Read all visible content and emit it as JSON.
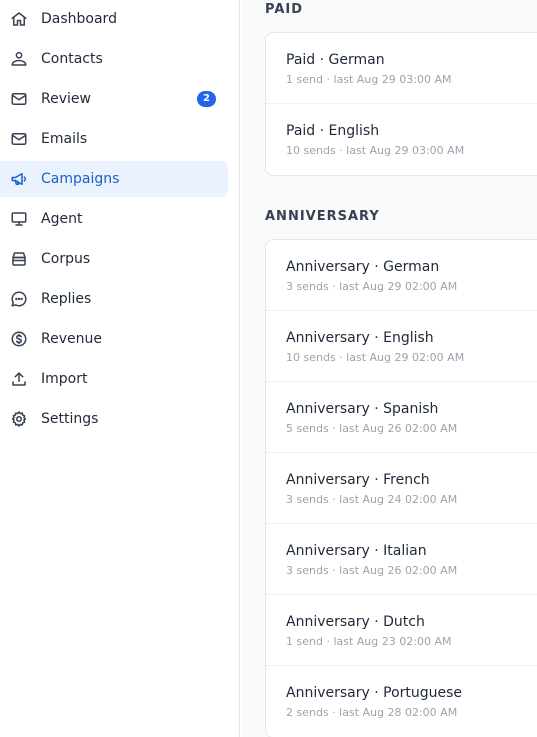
{
  "sidebar": {
    "items": [
      {
        "label": "Dashboard",
        "icon": "home-icon"
      },
      {
        "label": "Contacts",
        "icon": "contacts-icon"
      },
      {
        "label": "Review",
        "icon": "mail-icon",
        "badge": "2"
      },
      {
        "label": "Emails",
        "icon": "mail-icon"
      },
      {
        "label": "Campaigns",
        "icon": "megaphone-icon",
        "active": true
      },
      {
        "label": "Agent",
        "icon": "monitor-icon"
      },
      {
        "label": "Corpus",
        "icon": "archive-icon"
      },
      {
        "label": "Replies",
        "icon": "chat-icon"
      },
      {
        "label": "Revenue",
        "icon": "dollar-icon"
      },
      {
        "label": "Import",
        "icon": "upload-icon"
      },
      {
        "label": "Settings",
        "icon": "gear-icon"
      }
    ]
  },
  "main": {
    "sections": [
      {
        "title": "PAID",
        "rows": [
          {
            "title": "Paid · German",
            "subtitle": "1 send · last Aug 29 03:00 AM"
          },
          {
            "title": "Paid · English",
            "subtitle": "10 sends · last Aug 29 03:00 AM"
          }
        ]
      },
      {
        "title": "ANNIVERSARY",
        "rows": [
          {
            "title": "Anniversary · German",
            "subtitle": "3 sends · last Aug 29 02:00 AM"
          },
          {
            "title": "Anniversary · English",
            "subtitle": "10 sends · last Aug 29 02:00 AM"
          },
          {
            "title": "Anniversary · Spanish",
            "subtitle": "5 sends · last Aug 26 02:00 AM"
          },
          {
            "title": "Anniversary · French",
            "subtitle": "3 sends · last Aug 24 02:00 AM"
          },
          {
            "title": "Anniversary · Italian",
            "subtitle": "3 sends · last Aug 26 02:00 AM"
          },
          {
            "title": "Anniversary · Dutch",
            "subtitle": "1 send · last Aug 23 02:00 AM"
          },
          {
            "title": "Anniversary · Portuguese",
            "subtitle": "2 sends · last Aug 28 02:00 AM"
          }
        ]
      }
    ]
  },
  "colors": {
    "accent": "#2563eb",
    "active_bg": "#eaf2fd",
    "active_text": "#1d5fc9",
    "badge_bg": "#2563eb"
  }
}
